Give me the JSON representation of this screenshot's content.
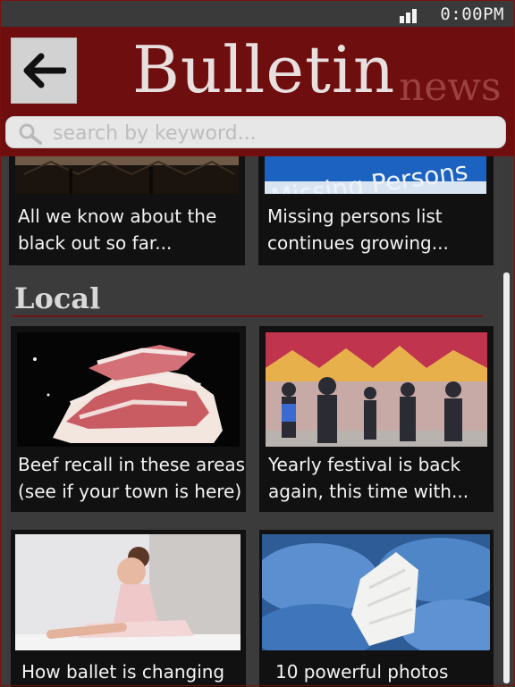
{
  "status": {
    "time": "0:00PM"
  },
  "header": {
    "back_icon": "arrow-left-icon",
    "brand": "Bulletin",
    "brand_suffix": "news"
  },
  "search": {
    "placeholder": "search by keyword...",
    "icon": "search-icon"
  },
  "top_articles": [
    {
      "line1": "All we know about the",
      "line2": "black out so far..."
    },
    {
      "line1": "Missing persons list",
      "line2": "continues growing..."
    }
  ],
  "top_image_text": "Missing Persons",
  "local": {
    "heading": "Local",
    "articles": [
      {
        "line1": "Beef recall in these areas",
        "line2": "(see if your town is here)"
      },
      {
        "line1": "Yearly festival is back",
        "line2": "again, this time with..."
      },
      {
        "line1": "How ballet is changing",
        "line2": ""
      },
      {
        "line1": "10 powerful photos",
        "line2": ""
      }
    ]
  },
  "colors": {
    "header": "#6e0e0e",
    "background": "#3b3b3b",
    "card": "#111111",
    "text": "#f4f4f4"
  }
}
